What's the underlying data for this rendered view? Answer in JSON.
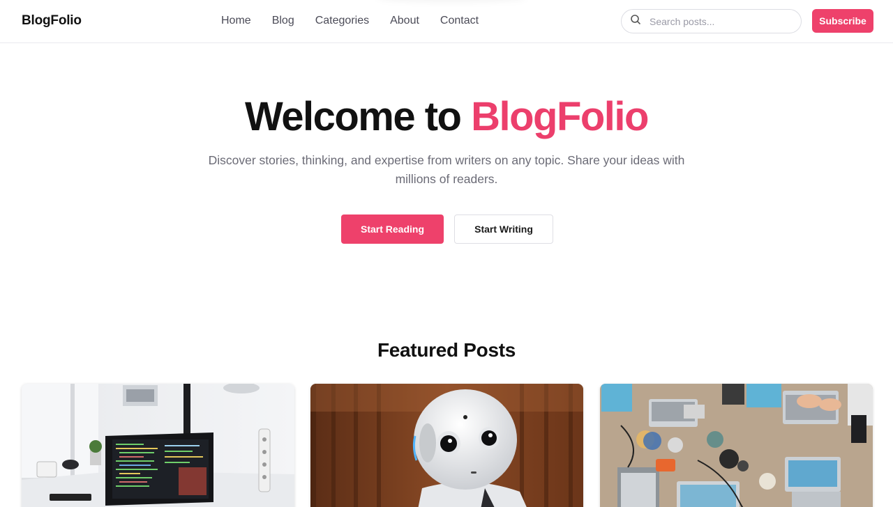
{
  "brand": "BlogFolio",
  "nav": {
    "links": [
      "Home",
      "Blog",
      "Categories",
      "About",
      "Contact"
    ]
  },
  "search": {
    "placeholder": "Search posts...",
    "icon": "search-icon"
  },
  "subscribe_label": "Subscribe",
  "hero": {
    "title_prefix": "Welcome to ",
    "title_accent": "BlogFolio",
    "subtitle": "Discover stories, thinking, and expertise from writers on any topic. Share your ideas with millions of readers.",
    "primary_cta": "Start Reading",
    "secondary_cta": "Start Writing"
  },
  "featured": {
    "title": "Featured Posts",
    "cards": [
      {
        "image": "laptop-workspace-image"
      },
      {
        "image": "robot-image"
      },
      {
        "image": "team-desk-laptops-image"
      }
    ]
  },
  "colors": {
    "accent": "#ee416b",
    "text": "#111111",
    "muted": "#6b6b76",
    "border": "#e9e9ee"
  }
}
